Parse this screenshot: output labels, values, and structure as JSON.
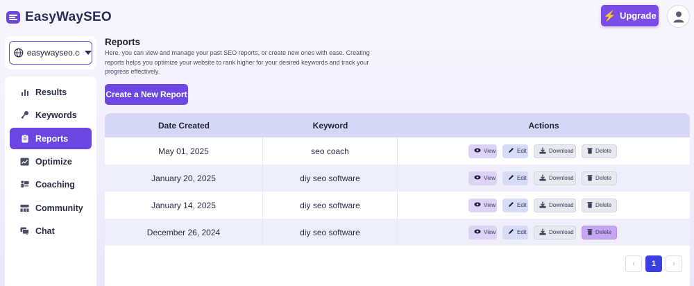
{
  "brand": {
    "name": "EasyWaySEO"
  },
  "header": {
    "upgrade_label": "Upgrade",
    "accent": "#7a4de8"
  },
  "site_selector": {
    "value": "easywayseo.com"
  },
  "sidebar": {
    "items": [
      {
        "label": "Results",
        "icon": "bar-chart-icon",
        "active": false
      },
      {
        "label": "Keywords",
        "icon": "key-icon",
        "active": false
      },
      {
        "label": "Reports",
        "icon": "clipboard-icon",
        "active": true
      },
      {
        "label": "Optimize",
        "icon": "trend-icon",
        "active": false
      },
      {
        "label": "Coaching",
        "icon": "coaching-icon",
        "active": false
      },
      {
        "label": "Community",
        "icon": "community-icon",
        "active": false
      },
      {
        "label": "Chat",
        "icon": "chat-icon",
        "active": false
      }
    ]
  },
  "main": {
    "title": "Reports",
    "description": "Here, you can view and manage your past SEO reports, or create new ones with ease. Creating reports helps you optimize your website to rank higher for your desired keywords and track your progress effectively.",
    "create_label": "Create a New Report"
  },
  "table": {
    "headers": [
      "Date Created",
      "Keyword",
      "Actions"
    ],
    "action_labels": {
      "view": "View",
      "edit": "Edit",
      "download": "Download",
      "delete": "Delete"
    },
    "rows": [
      {
        "date": "May 01, 2025",
        "keyword": "seo coach"
      },
      {
        "date": "January 20, 2025",
        "keyword": "diy seo software"
      },
      {
        "date": "January 14, 2025",
        "keyword": "diy seo software"
      },
      {
        "date": "December 26, 2024",
        "keyword": "diy seo software"
      }
    ]
  },
  "pagination": {
    "prev": "‹",
    "current": "1",
    "next": "›"
  }
}
